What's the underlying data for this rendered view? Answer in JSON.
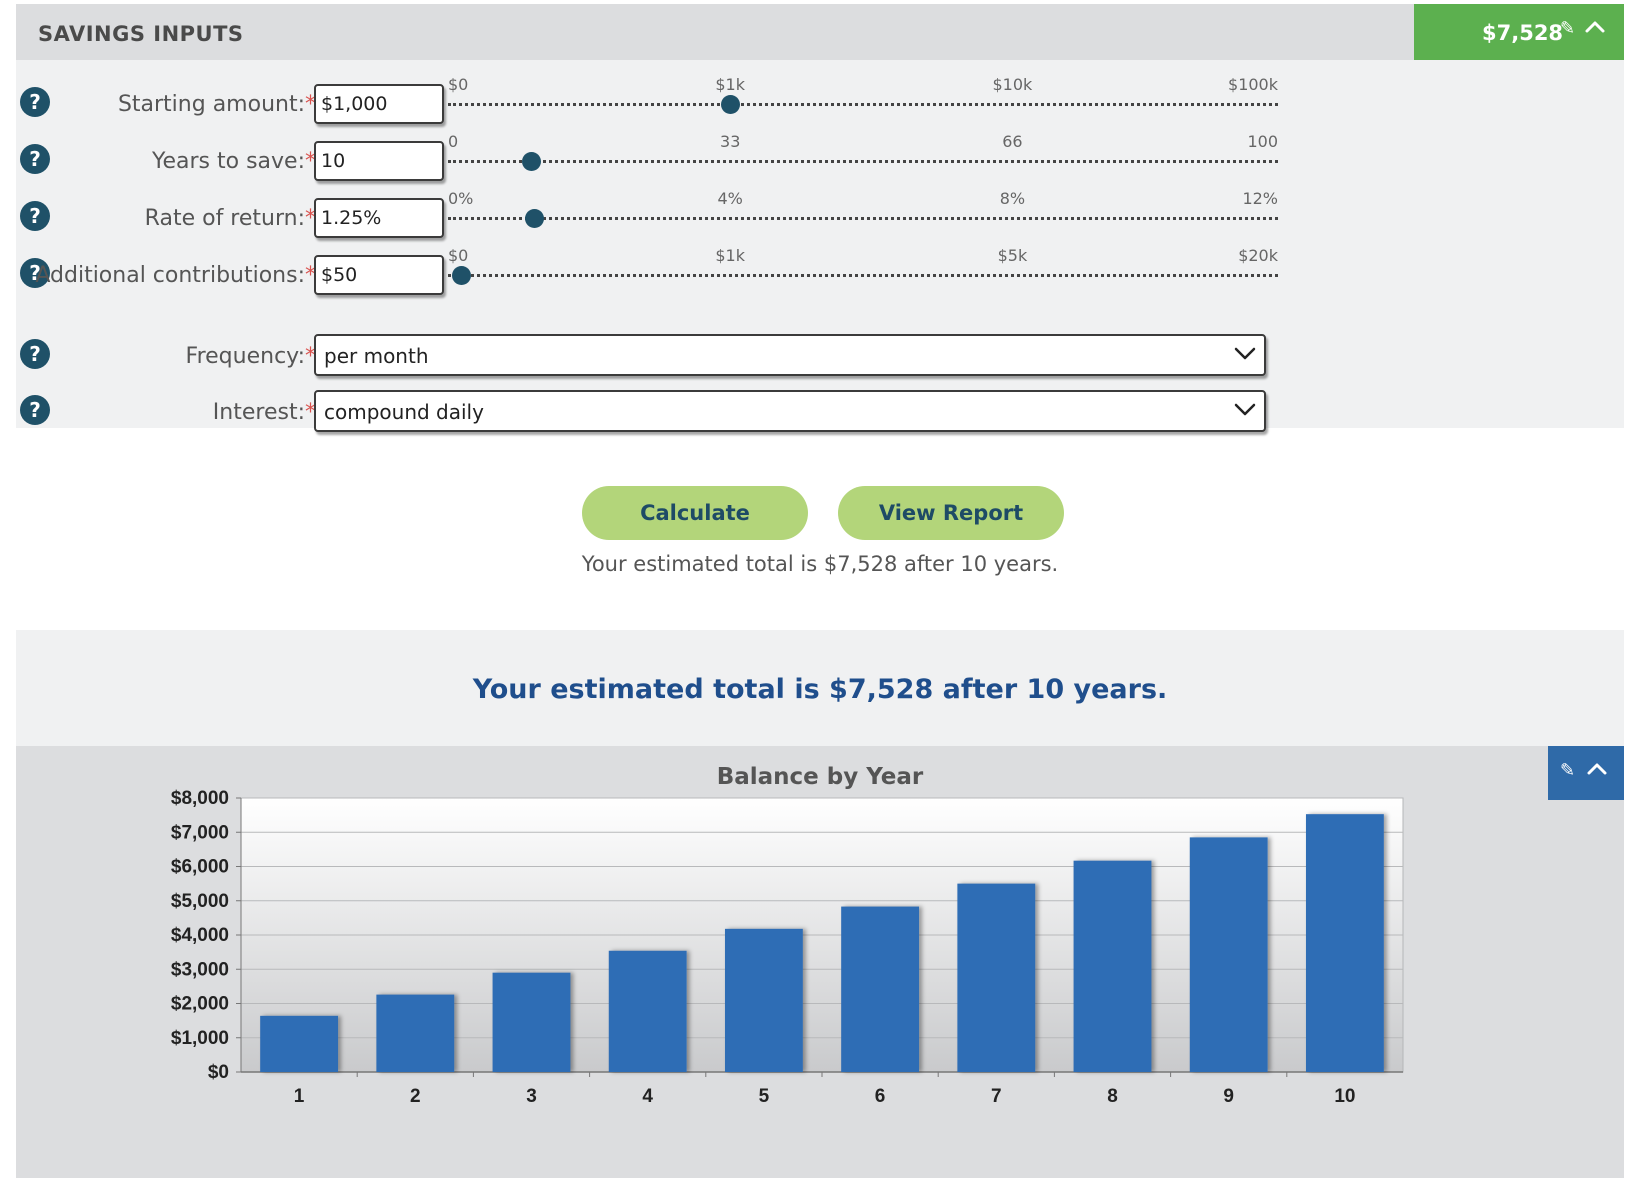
{
  "inputs": {
    "title": "SAVINGS INPUTS",
    "total_badge": "$7,528",
    "rows": [
      {
        "label": "Starting amount:",
        "required": "*",
        "value": "$1,000",
        "ticks": [
          "$0",
          "$1k",
          "$10k",
          "$100k"
        ],
        "thumb_fraction": 0.34
      },
      {
        "label": "Years to save:",
        "required": "*",
        "value": "10",
        "ticks": [
          "0",
          "33",
          "66",
          "100"
        ],
        "thumb_fraction": 0.1
      },
      {
        "label": "Rate of return:",
        "required": "*",
        "value": "1.25%",
        "ticks": [
          "0%",
          "4%",
          "8%",
          "12%"
        ],
        "thumb_fraction": 0.104
      },
      {
        "label": "Additional contributions:",
        "required": "*",
        "value": "$50",
        "ticks": [
          "$0",
          "$1k",
          "$5k",
          "$20k"
        ],
        "thumb_fraction": 0.016
      }
    ],
    "frequency": {
      "label": "Frequency:",
      "required": "*",
      "value": "per month"
    },
    "interest": {
      "label": "Interest:",
      "required": "*",
      "value": "compound daily"
    },
    "help_glyph": "?"
  },
  "buttons": {
    "calculate": "Calculate",
    "view_report": "View Report"
  },
  "summary_text": "Your estimated total is $7,528 after 10 years.",
  "results_headline": "Your estimated total is $7,528 after 10 years.",
  "chart": {
    "title": "Balance by Year"
  },
  "colors": {
    "header_green": "#5cb04f",
    "button_green": "#b3d57a",
    "bar_blue": "#2f6db5",
    "dark_teal": "#1f5168",
    "headline_blue": "#1f4e8c"
  },
  "chart_data": {
    "type": "bar",
    "title": "Balance by Year",
    "categories": [
      "1",
      "2",
      "3",
      "4",
      "5",
      "6",
      "7",
      "8",
      "9",
      "10"
    ],
    "values": [
      1640,
      2260,
      2900,
      3540,
      4180,
      4830,
      5500,
      6170,
      6850,
      7528
    ],
    "ylim": [
      0,
      8000
    ],
    "yticks": [
      "$0",
      "$1,000",
      "$2,000",
      "$3,000",
      "$4,000",
      "$5,000",
      "$6,000",
      "$7,000",
      "$8,000"
    ],
    "grid": true,
    "xlabel": "",
    "ylabel": ""
  }
}
